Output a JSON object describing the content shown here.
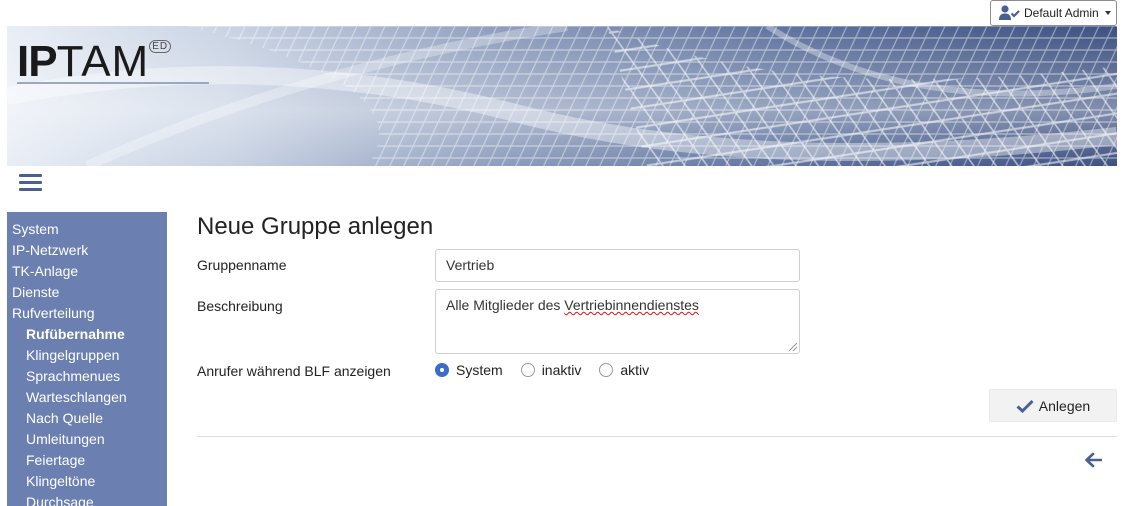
{
  "header": {
    "user_label": "Default Admin",
    "logo_text_bold": "IP",
    "logo_text": "TAM",
    "logo_badge": "ED"
  },
  "colors": {
    "sidebar_bg": "#6b7fb0",
    "accent": "#3a6cc8",
    "icon": "#4a6090"
  },
  "sidebar": {
    "items": [
      {
        "label": "System",
        "level": 0,
        "active": false
      },
      {
        "label": "IP-Netzwerk",
        "level": 0,
        "active": false
      },
      {
        "label": "TK-Anlage",
        "level": 0,
        "active": false
      },
      {
        "label": "Dienste",
        "level": 0,
        "active": false
      },
      {
        "label": "Rufverteilung",
        "level": 0,
        "active": false
      },
      {
        "label": "Rufübernahme",
        "level": 1,
        "active": true
      },
      {
        "label": "Klingelgruppen",
        "level": 1,
        "active": false
      },
      {
        "label": "Sprachmenues",
        "level": 1,
        "active": false
      },
      {
        "label": "Warteschlangen",
        "level": 1,
        "active": false
      },
      {
        "label": "Nach Quelle",
        "level": 1,
        "active": false
      },
      {
        "label": "Umleitungen",
        "level": 1,
        "active": false
      },
      {
        "label": "Feiertage",
        "level": 1,
        "active": false
      },
      {
        "label": "Klingeltöne",
        "level": 1,
        "active": false
      },
      {
        "label": "Durchsage",
        "level": 1,
        "active": false
      }
    ]
  },
  "main": {
    "title": "Neue Gruppe anlegen",
    "fields": {
      "name_label": "Gruppenname",
      "name_value": "Vertrieb",
      "desc_label": "Beschreibung",
      "desc_prefix": "Alle Mitglieder des ",
      "desc_misspelled": "Vertriebinnendienstes",
      "blf_label": "Anrufer während BLF anzeigen",
      "blf_options": [
        {
          "label": "System",
          "checked": true
        },
        {
          "label": "inaktiv",
          "checked": false
        },
        {
          "label": "aktiv",
          "checked": false
        }
      ]
    },
    "submit_label": "Anlegen"
  }
}
